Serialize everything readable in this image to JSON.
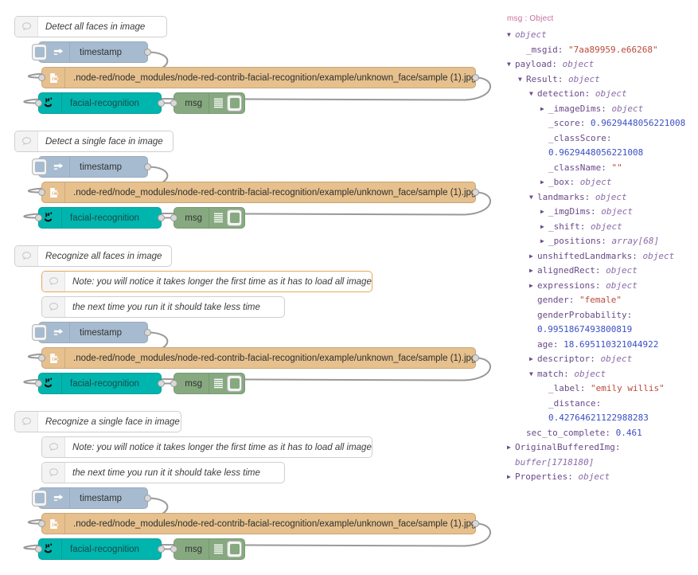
{
  "flow": {
    "groups": [
      {
        "title": "Detect all faces in image",
        "notes": [],
        "inject_label": "timestamp",
        "file_label": ".node-red/node_modules/node-red-contrib-facial-recognition/example/unknown_face/sample (1).jpg",
        "facial_label": "facial-recognition",
        "debug_label": "msg"
      },
      {
        "title": "Detect a single face in image",
        "notes": [],
        "inject_label": "timestamp",
        "file_label": ".node-red/node_modules/node-red-contrib-facial-recognition/example/unknown_face/sample (1).jpg",
        "facial_label": "facial-recognition",
        "debug_label": "msg"
      },
      {
        "title": "Recognize all faces in image",
        "notes": [
          "Note: you will notice it takes longer the first time as it has to load all images",
          "the next time you run it it should take less time"
        ],
        "inject_label": "timestamp",
        "file_label": ".node-red/node_modules/node-red-contrib-facial-recognition/example/unknown_face/sample (1).jpg",
        "facial_label": "facial-recognition",
        "debug_label": "msg"
      },
      {
        "title": "Recognize a single face in image",
        "notes": [
          "Note: you will notice it takes longer the first time as it has to load all images",
          "the next time you run it it should take less time"
        ],
        "inject_label": "timestamp",
        "file_label": ".node-red/node_modules/node-red-contrib-facial-recognition/example/unknown_face/sample (1).jpg",
        "facial_label": "facial-recognition",
        "debug_label": "msg"
      }
    ],
    "colors": {
      "inject": "#a6bbcf",
      "file": "#e6c08d",
      "facial": "#00b5ad",
      "debug": "#87a980",
      "wire": "#999999",
      "note_selected_border": "#e8a75a"
    }
  },
  "sidebar": {
    "header": "msg : Object",
    "tree": [
      {
        "indent": 0,
        "tri": "down",
        "key": "",
        "type": "object",
        "wrap": false
      },
      {
        "indent": 1,
        "tri": "none",
        "key": "_msgid",
        "str": "\"7aa89959.e66268\""
      },
      {
        "indent": 0,
        "tri": "down",
        "key": "payload",
        "type": "object"
      },
      {
        "indent": 1,
        "tri": "down",
        "key": "Result",
        "type": "object"
      },
      {
        "indent": 2,
        "tri": "down",
        "key": "detection",
        "type": "object"
      },
      {
        "indent": 3,
        "tri": "right",
        "key": "_imageDims",
        "type": "object"
      },
      {
        "indent": 3,
        "tri": "none",
        "key": "_score",
        "num": "0.9629448056221008"
      },
      {
        "indent": 3,
        "tri": "none",
        "key": "_classScore",
        "num": "0.9629448056221008",
        "wrap": true
      },
      {
        "indent": 3,
        "tri": "none",
        "key": "_className",
        "str": "\"\""
      },
      {
        "indent": 3,
        "tri": "right",
        "key": "_box",
        "type": "object"
      },
      {
        "indent": 2,
        "tri": "down",
        "key": "landmarks",
        "type": "object"
      },
      {
        "indent": 3,
        "tri": "right",
        "key": "_imgDims",
        "type": "object"
      },
      {
        "indent": 3,
        "tri": "right",
        "key": "_shift",
        "type": "object"
      },
      {
        "indent": 3,
        "tri": "right",
        "key": "_positions",
        "type": "array[68]"
      },
      {
        "indent": 2,
        "tri": "right",
        "key": "unshiftedLandmarks",
        "type": "object"
      },
      {
        "indent": 2,
        "tri": "right",
        "key": "alignedRect",
        "type": "object"
      },
      {
        "indent": 2,
        "tri": "right",
        "key": "expressions",
        "type": "object"
      },
      {
        "indent": 2,
        "tri": "none",
        "key": "gender",
        "str": "\"female\""
      },
      {
        "indent": 2,
        "tri": "none",
        "key": "genderProbability",
        "num": "0.9951867493800819",
        "wrap": true
      },
      {
        "indent": 2,
        "tri": "none",
        "key": "age",
        "num": "18.695110321044922"
      },
      {
        "indent": 2,
        "tri": "right",
        "key": "descriptor",
        "type": "object"
      },
      {
        "indent": 2,
        "tri": "down",
        "key": "match",
        "type": "object"
      },
      {
        "indent": 3,
        "tri": "none",
        "key": "_label",
        "str": "\"emily willis\""
      },
      {
        "indent": 3,
        "tri": "none",
        "key": "_distance",
        "num": "0.42764621122988283",
        "wrap": true
      },
      {
        "indent": 1,
        "tri": "none",
        "key": "sec_to_complete",
        "num": "0.461"
      },
      {
        "indent": 0,
        "tri": "right",
        "key": "OriginalBufferedImg",
        "type": "buffer[1718180]",
        "wrap": true
      },
      {
        "indent": 0,
        "tri": "right",
        "key": "Properties",
        "type": "object"
      }
    ]
  }
}
